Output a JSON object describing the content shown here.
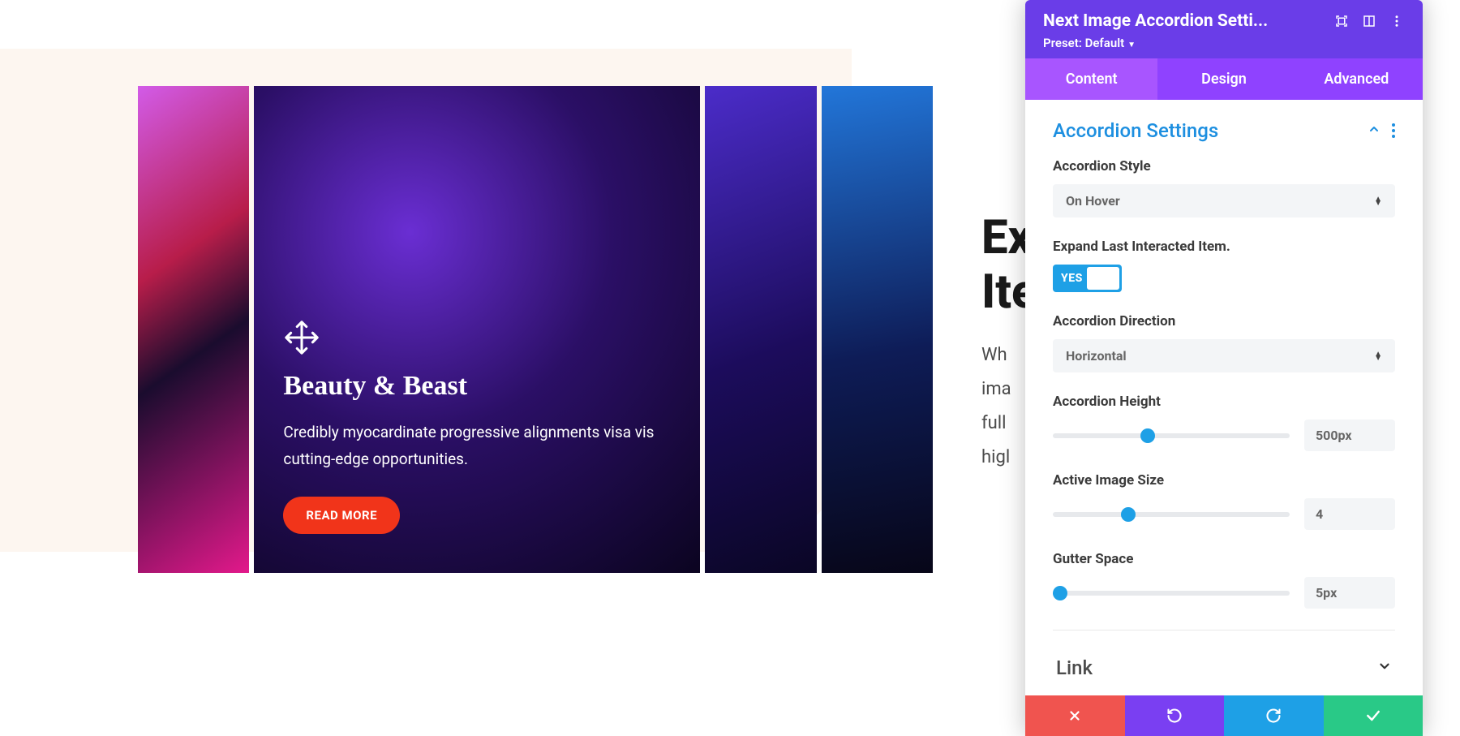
{
  "preview": {
    "overlay_title": "Beauty & Beast",
    "overlay_desc": "Credibly myocardinate progressive alignments visa vis cutting-edge opportunities.",
    "read_more_label": "READ MORE"
  },
  "side_text": {
    "h1_line1": "Ex",
    "h1_line2": "Ite",
    "p_line1": "Wh",
    "p_line2": "ima",
    "p_line3": "full",
    "p_line4": "higl"
  },
  "panel": {
    "title": "Next Image Accordion Setti...",
    "preset_label": "Preset: Default",
    "tabs": {
      "content": "Content",
      "design": "Design",
      "advanced": "Advanced",
      "active": "content"
    },
    "section_title": "Accordion Settings",
    "fields": {
      "style": {
        "label": "Accordion Style",
        "value": "On Hover"
      },
      "expand_last": {
        "label": "Expand Last Interacted Item.",
        "value": "YES"
      },
      "direction": {
        "label": "Accordion Direction",
        "value": "Horizontal"
      },
      "height": {
        "label": "Accordion Height",
        "value": "500px",
        "thumb_pct": 40
      },
      "active_size": {
        "label": "Active Image Size",
        "value": "4",
        "thumb_pct": 32
      },
      "gutter": {
        "label": "Gutter Space",
        "value": "5px",
        "thumb_pct": 3
      }
    },
    "link_section": "Link"
  }
}
